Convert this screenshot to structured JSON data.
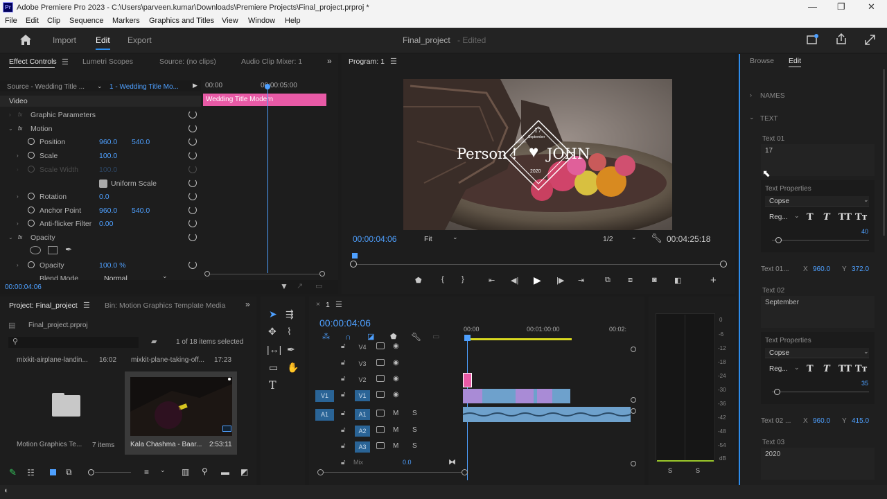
{
  "window": {
    "title": "Adobe Premiere Pro 2023 - C:\\Users\\parveen.kumar\\Downloads\\Premiere Projects\\Final_project.prproj *",
    "logo_text": "Pr",
    "minimize": "—",
    "maximize": "❐",
    "close": "✕"
  },
  "menu": [
    "File",
    "Edit",
    "Clip",
    "Sequence",
    "Markers",
    "Graphics and Titles",
    "View",
    "Window",
    "Help"
  ],
  "header": {
    "tabs": [
      "Import",
      "Edit",
      "Export"
    ],
    "project_name": "Final_project",
    "status": "- Edited"
  },
  "effect_controls": {
    "tabs": [
      "Effect Controls",
      "Lumetri Scopes",
      "Source: (no clips)",
      "Audio Clip Mixer: 1"
    ],
    "source": "Source - Wedding Title ...",
    "sequence": "1 - Wedding Title Mo...",
    "ruler": [
      "00:00",
      "00:00:05:00"
    ],
    "clip_name": "Wedding Title Modern",
    "video_label": "Video",
    "graphic_params": "Graphic Parameters",
    "motion": "Motion",
    "position": {
      "label": "Position",
      "x": "960.0",
      "y": "540.0"
    },
    "scale": {
      "label": "Scale",
      "value": "100.0"
    },
    "scale_width": {
      "label": "Scale Width",
      "value": "100.0"
    },
    "uniform_scale": "Uniform Scale",
    "rotation": {
      "label": "Rotation",
      "value": "0.0"
    },
    "anchor": {
      "label": "Anchor Point",
      "x": "960.0",
      "y": "540.0"
    },
    "antiflicker": {
      "label": "Anti-flicker Filter",
      "value": "0.00"
    },
    "opacity_group": "Opacity",
    "opacity": {
      "label": "Opacity",
      "value": "100.0 %"
    },
    "blend": {
      "label": "Blend Mode",
      "value": "Normal"
    },
    "timecode": "00:00:04:06"
  },
  "program": {
    "title": "Program: 1",
    "timecode": "00:00:04:06",
    "fit": "Fit",
    "quality": "1/2",
    "duration": "00:04:25:18",
    "overlay": {
      "day": "17",
      "month": "September",
      "left": "Person !",
      "right": "JOHN",
      "year": "2020"
    }
  },
  "project": {
    "tabs": [
      "Project: Final_project",
      "Bin: Motion Graphics Template Media"
    ],
    "file": "Final_project.prproj",
    "count": "1 of 18 items selected",
    "items_top": [
      {
        "name": "mixkit-airplane-landin...",
        "dur": "16:02"
      },
      {
        "name": "mixkit-plane-taking-off...",
        "dur": "17:23"
      }
    ],
    "folder": {
      "name": "Motion Graphics Te...",
      "count": "7 items"
    },
    "clip": {
      "name": "Kala Chashma - Baar...",
      "dur": "2:53:11"
    }
  },
  "timeline": {
    "seq": "1",
    "timecode": "00:00:04:06",
    "ruler": [
      "00:00",
      "00:01:00:00",
      "00:02:"
    ],
    "video_tracks": [
      "V4",
      "V3",
      "V2",
      "V1"
    ],
    "audio_tracks": [
      "A1",
      "A2",
      "A3"
    ],
    "source_v": "V1",
    "source_a": "A1",
    "mix_label": "Mix",
    "mix_value": "0.0",
    "m_label": "M",
    "s_label": "S"
  },
  "meter": {
    "ticks": [
      "0",
      "-6",
      "-12",
      "-18",
      "-24",
      "-30",
      "-36",
      "-42",
      "-48",
      "-54",
      "dB"
    ],
    "s1": "S",
    "s2": "S"
  },
  "edit_panel": {
    "tabs": [
      "Browse",
      "Edit"
    ],
    "names": "NAMES",
    "text": "TEXT",
    "t1": {
      "label": "Text 01",
      "value": "17",
      "props": "Text Properties",
      "font": "Copse",
      "style": "Reg...",
      "size": "40",
      "pos_label": "Text 01...",
      "x": "960.0",
      "y": "372.0"
    },
    "t2": {
      "label": "Text 02",
      "value": "September",
      "props": "Text Properties",
      "font": "Copse",
      "style": "Reg...",
      "size": "35",
      "pos_label": "Text 02 ...",
      "x": "960.0",
      "y": "415.0"
    },
    "t3": {
      "label": "Text 03",
      "value": "2020"
    },
    "x_label": "X",
    "y_label": "Y"
  },
  "colors": {
    "accent": "#2d8ceb",
    "clip_pink": "#e85aa6",
    "clip_violet": "#a98bd6",
    "clip_audio": "#6ea1cc",
    "timecode_blue": "#4ea0ff"
  }
}
